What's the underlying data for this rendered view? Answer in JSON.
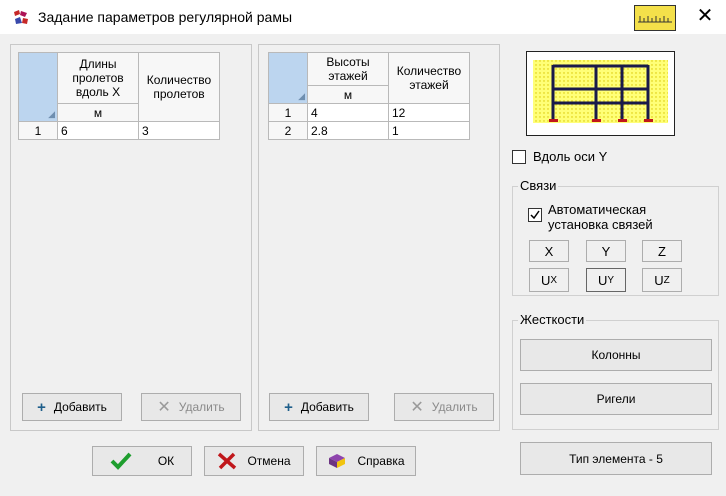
{
  "window": {
    "title": "Задание параметров регулярной рамы"
  },
  "spans": {
    "header_col1": "Длины пролетов вдоль X",
    "header_col2": "Количество пролетов",
    "unit": "м",
    "rows": [
      {
        "num": "1",
        "length": "6",
        "count": "3"
      }
    ],
    "add_label": "Добавить",
    "delete_label": "Удалить"
  },
  "floors": {
    "header_col1": "Высоты этажей",
    "header_col2": "Количество этажей",
    "unit": "м",
    "rows": [
      {
        "num": "1",
        "height": "4",
        "count": "12"
      },
      {
        "num": "2",
        "height": "2.8",
        "count": "1"
      }
    ],
    "add_label": "Добавить",
    "delete_label": "Удалить"
  },
  "options": {
    "along_y_label": "Вдоль оси Y",
    "along_y_checked": false
  },
  "links": {
    "group_title": "Связи",
    "auto_label": "Автоматическая установка связей",
    "auto_checked": true,
    "buttons": [
      "X",
      "Y",
      "Z"
    ],
    "rot_buttons": [
      {
        "main": "U",
        "sub": "X"
      },
      {
        "main": "U",
        "sub": "Y"
      },
      {
        "main": "U",
        "sub": "Z"
      }
    ]
  },
  "stiffness": {
    "group_title": "Жесткости",
    "columns_label": "Колонны",
    "beams_label": "Ригели"
  },
  "element_type_label": "Тип элемента - 5",
  "footer": {
    "ok_label": "ОК",
    "cancel_label": "Отмена",
    "help_label": "Справка"
  },
  "colors": {
    "accent_green": "#1e9e2e",
    "cancel_red": "#c0171b",
    "preview_yellow": "#ffff66"
  }
}
